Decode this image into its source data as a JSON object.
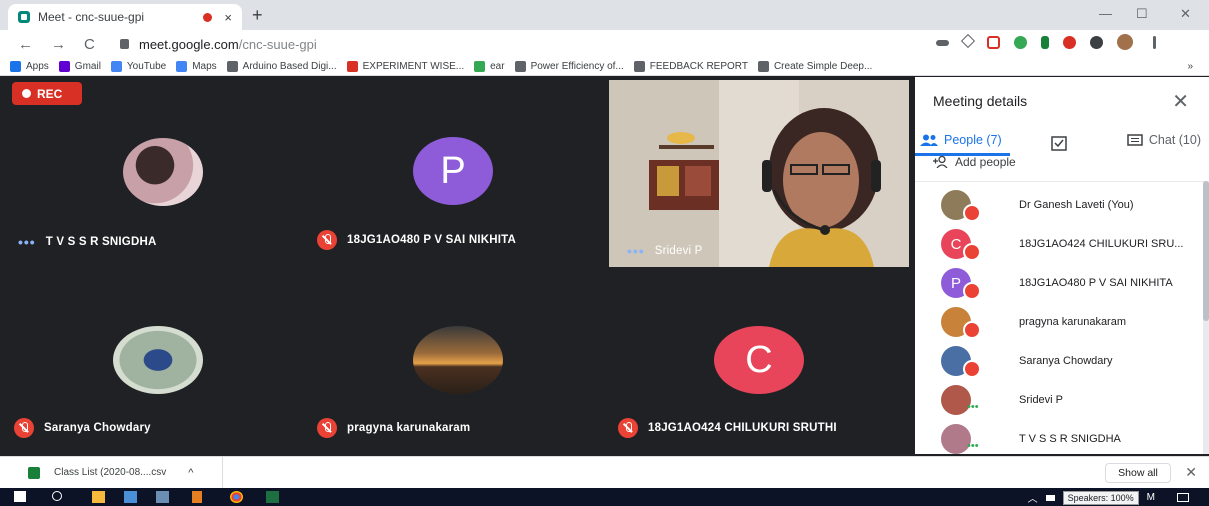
{
  "browser": {
    "tab_title": "Meet - cnc-suue-gpi",
    "tab_close": "×",
    "new_tab": "+",
    "window_controls": [
      "—",
      "☐",
      "✕"
    ],
    "url_host": "meet.google.com",
    "url_path": "/cnc-suue-gpi",
    "nav": [
      "←",
      "→",
      "C"
    ],
    "bookmarks": [
      {
        "label": "Apps",
        "color": "#1a73e8"
      },
      {
        "label": "Gmail",
        "color": "#6001d2"
      },
      {
        "label": "YouTube",
        "color": "#4285f4"
      },
      {
        "label": "Maps",
        "color": "#4285f4"
      },
      {
        "label": "Arduino Based Digi...",
        "color": "#5f6368"
      },
      {
        "label": "EXPERIMENT WISE...",
        "color": "#d93025"
      },
      {
        "label": "ear",
        "color": "#34a853"
      },
      {
        "label": "Power Efficiency of...",
        "color": "#5f6368"
      },
      {
        "label": "FEEDBACK REPORT",
        "color": "#5f6368"
      },
      {
        "label": "Create Simple Deep...",
        "color": "#5f6368"
      }
    ],
    "bookmarks_more": "»"
  },
  "meet": {
    "rec_label": "REC",
    "tiles": [
      {
        "name": "T V S S R SNIGDHA",
        "status": "dots",
        "avatar": "photo",
        "color": "#b07a8a"
      },
      {
        "name": "18JG1AO480 P V SAI NIKHITA",
        "status": "muted",
        "avatar": "P",
        "color": "#8e5cd9"
      },
      {
        "name": "Sridevi P",
        "status": "dots",
        "avatar": "video",
        "color": "#d6cdc2"
      },
      {
        "name": "Saranya Chowdary",
        "status": "muted",
        "avatar": "photo",
        "color": "#4a6fa5"
      },
      {
        "name": "pragyna karunakaram",
        "status": "muted",
        "avatar": "photo",
        "color": "#c9823a"
      },
      {
        "name": "18JG1AO424 CHILUKURI SRUTHI",
        "status": "muted",
        "avatar": "C",
        "color": "#e8445a"
      }
    ]
  },
  "panel": {
    "title": "Meeting details",
    "close": "✕",
    "tab_people": "People (7)",
    "tab_chat": "Chat (10)",
    "add_people": "Add people",
    "people": [
      {
        "name": "Dr Ganesh Laveti (You)",
        "status": "muted",
        "avatar": "",
        "color": "#8d7b5a"
      },
      {
        "name": "18JG1AO424 CHILUKURI SRU...",
        "status": "muted",
        "avatar": "C",
        "color": "#e8445a"
      },
      {
        "name": "18JG1AO480 P V SAI NIKHITA",
        "status": "muted",
        "avatar": "P",
        "color": "#8e5cd9"
      },
      {
        "name": "pragyna karunakaram",
        "status": "muted",
        "avatar": "",
        "color": "#c9823a"
      },
      {
        "name": "Saranya Chowdary",
        "status": "muted",
        "avatar": "",
        "color": "#4a6fa5"
      },
      {
        "name": "Sridevi P",
        "status": "dots",
        "avatar": "",
        "color": "#b0584a"
      },
      {
        "name": "T V S S R SNIGDHA",
        "status": "dots",
        "avatar": "",
        "color": "#b07a8a"
      }
    ]
  },
  "downloads": {
    "file": "Class List (2020-08....csv",
    "chevron": "^",
    "show_all": "Show all",
    "close": "✕"
  },
  "taskbar": {
    "tooltip": "Speakers: 100%",
    "clock_fragment": "M"
  }
}
